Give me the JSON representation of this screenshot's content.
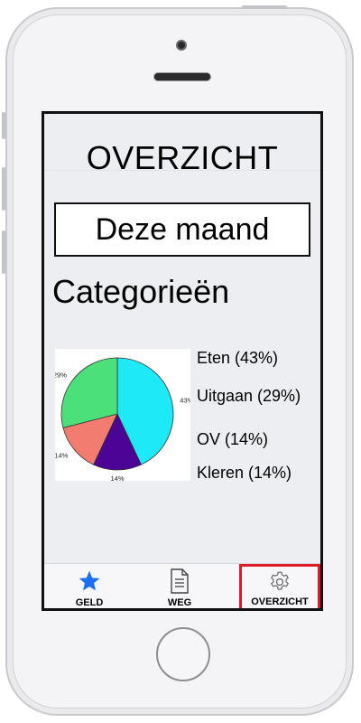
{
  "screen": {
    "title": "OVERZICHT",
    "period": "Deze maand",
    "section_title": "Categorieën"
  },
  "chart_data": {
    "type": "pie",
    "slices": [
      {
        "name": "Eten",
        "value": 43,
        "label": "43%",
        "color": "#1de9f7"
      },
      {
        "name": "OV",
        "value": 14,
        "label": "14%",
        "color": "#4b0496"
      },
      {
        "name": "Kleren",
        "value": 14,
        "label": "14%",
        "color": "#f27c70"
      },
      {
        "name": "Uitgaan",
        "value": 29,
        "label": "29%",
        "color": "#4be07a"
      }
    ]
  },
  "legend": [
    {
      "text": "Eten (43%)"
    },
    {
      "text": "Uitgaan (29%)"
    },
    {
      "text": "OV (14%)"
    },
    {
      "text": "Kleren (14%)"
    }
  ],
  "tabbar": {
    "tabs": [
      {
        "label": "GELD",
        "icon": "star-icon",
        "color": "#1e6ff0"
      },
      {
        "label": "WEG",
        "icon": "document-icon"
      },
      {
        "label": "OVERZICHT",
        "icon": "gear-icon",
        "selected": true,
        "highlight": "#e01a2b"
      }
    ]
  }
}
